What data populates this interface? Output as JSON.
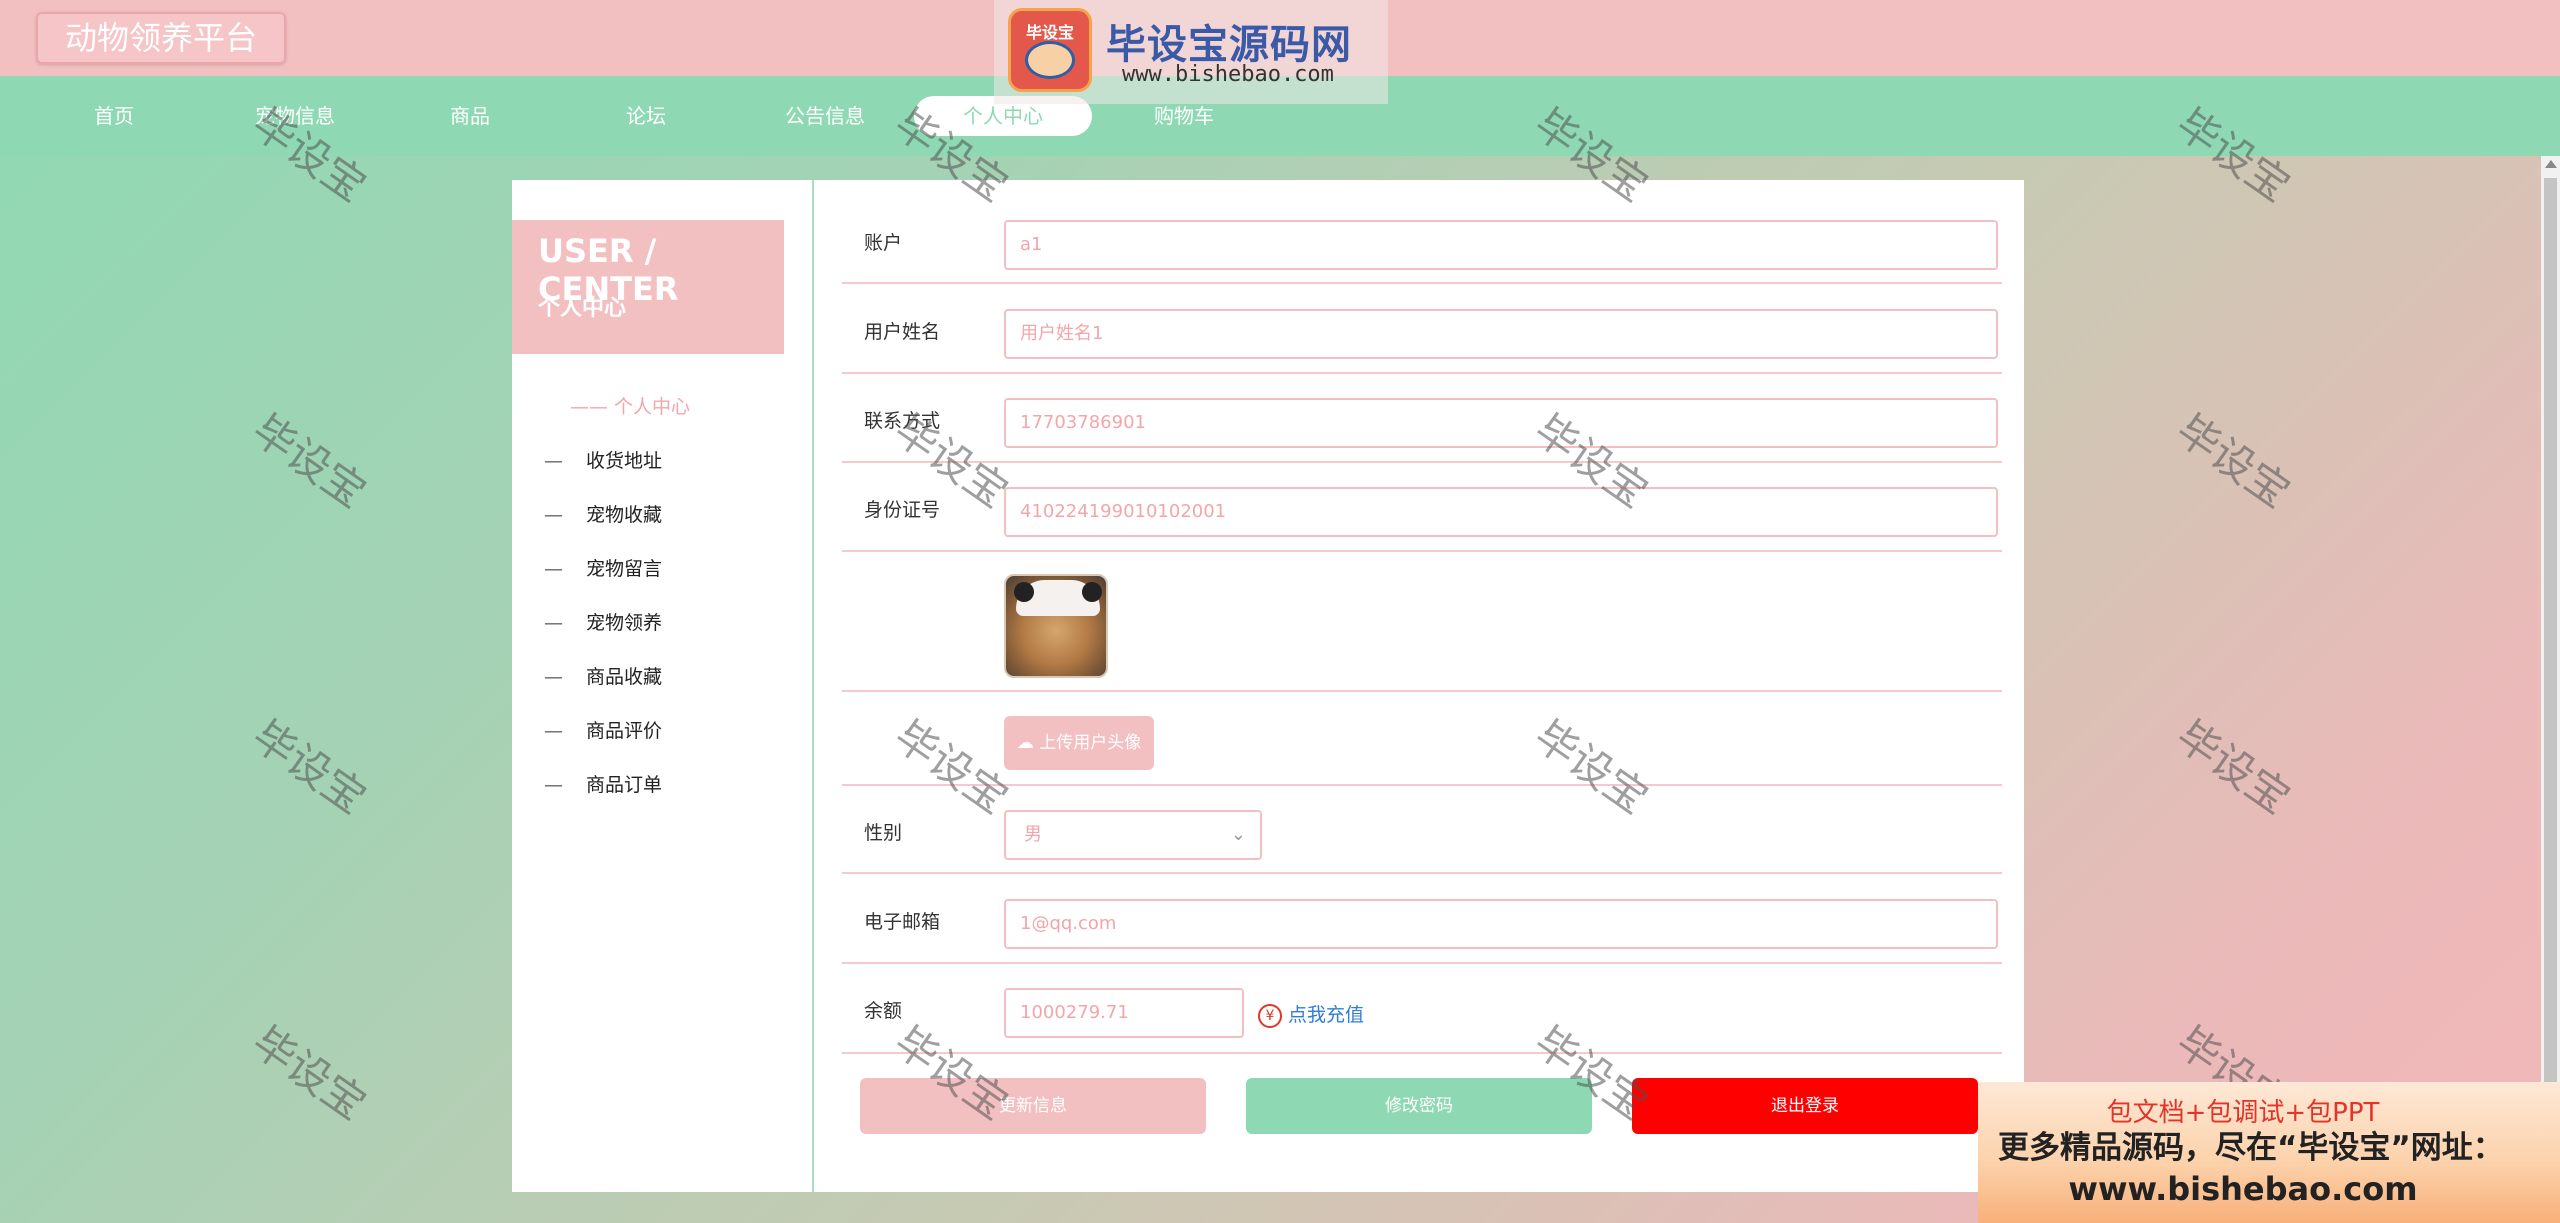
{
  "brand": {
    "title": "动物领养平台"
  },
  "watermark": {
    "banner_logo_text": "毕设宝",
    "banner_title": "毕设宝源码网",
    "banner_url": "www.bishebao.com",
    "diagonal_text": "毕设宝"
  },
  "nav": {
    "items": [
      {
        "label": "首页"
      },
      {
        "label": "宠物信息"
      },
      {
        "label": "商品"
      },
      {
        "label": "论坛"
      },
      {
        "label": "公告信息"
      },
      {
        "label": "个人中心"
      },
      {
        "label": "购物车"
      }
    ],
    "active_index": 5
  },
  "sidebar": {
    "title_en": "USER / CENTER",
    "title_cn": "个人中心",
    "active_label": "—— 个人中心",
    "dash": "—",
    "items": [
      {
        "label": "收货地址"
      },
      {
        "label": "宠物收藏"
      },
      {
        "label": "宠物留言"
      },
      {
        "label": "宠物领养"
      },
      {
        "label": "商品收藏"
      },
      {
        "label": "商品评价"
      },
      {
        "label": "商品订单"
      }
    ]
  },
  "form": {
    "account": {
      "label": "账户",
      "value": "a1"
    },
    "username": {
      "label": "用户姓名",
      "value": "用户姓名1"
    },
    "phone": {
      "label": "联系方式",
      "value": "17703786901"
    },
    "idcard": {
      "label": "身份证号",
      "value": "410224199010102001"
    },
    "upload_label": "上传用户头像",
    "upload_icon": "cloud-upload-icon",
    "gender": {
      "label": "性别",
      "value": "男"
    },
    "email": {
      "label": "电子邮箱",
      "value": "1@qq.com"
    },
    "balance": {
      "label": "余额",
      "value": "1000279.71"
    },
    "recharge_label": "点我充值",
    "recharge_icon_glyph": "¥"
  },
  "buttons": {
    "update": "更新信息",
    "change_password": "修改密码",
    "logout": "退出登录"
  },
  "promo": {
    "line1": "包文档+包调试+包PPT",
    "line2": "更多精品源码，尽在“毕设宝”网址：",
    "line3": "www.bishebao.com"
  },
  "colors": {
    "pink": "#f3c0c2",
    "mint": "#8ed9b3",
    "logout_red": "#ff0000",
    "link_blue": "#2f7dd4"
  }
}
